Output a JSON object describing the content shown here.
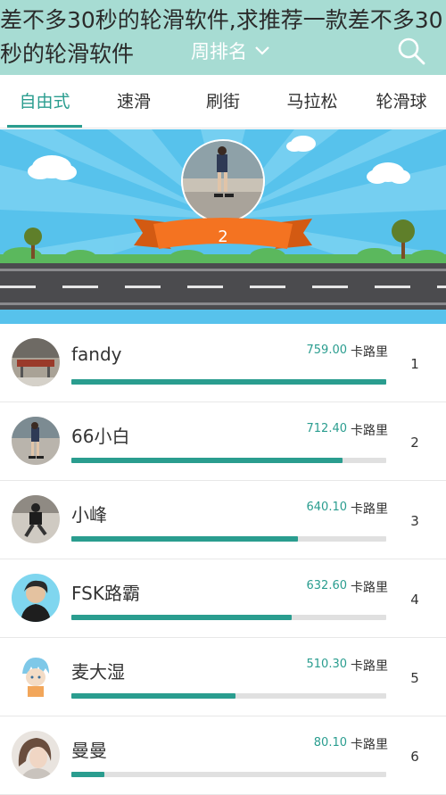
{
  "overlay_title": "差不多30秒的轮滑软件,求推荐一款差不多30 秒的轮滑软件",
  "header": {
    "title": "周排名"
  },
  "tabs": [
    "自由式",
    "速滑",
    "刷街",
    "马拉松",
    "轮滑球"
  ],
  "banner": {
    "rank": "2"
  },
  "list": {
    "unit": "卡路里",
    "items": [
      {
        "name": "fandy",
        "score": "759.00",
        "fraction": 1.0,
        "rank": "1"
      },
      {
        "name": "66小白",
        "score": "712.40",
        "fraction": 0.86,
        "rank": "2"
      },
      {
        "name": "小峰",
        "score": "640.10",
        "fraction": 0.72,
        "rank": "3"
      },
      {
        "name": "FSK路霸",
        "score": "632.60",
        "fraction": 0.7,
        "rank": "4"
      },
      {
        "name": "麦大湿",
        "score": "510.30",
        "fraction": 0.52,
        "rank": "5"
      },
      {
        "name": "曼曼",
        "score": "80.10",
        "fraction": 0.106,
        "rank": "6"
      }
    ]
  },
  "colors": {
    "accent": "#2a9d8f",
    "header": "#a7dcd3",
    "sky": "#57c2ec",
    "ribbon": "#f47321"
  }
}
